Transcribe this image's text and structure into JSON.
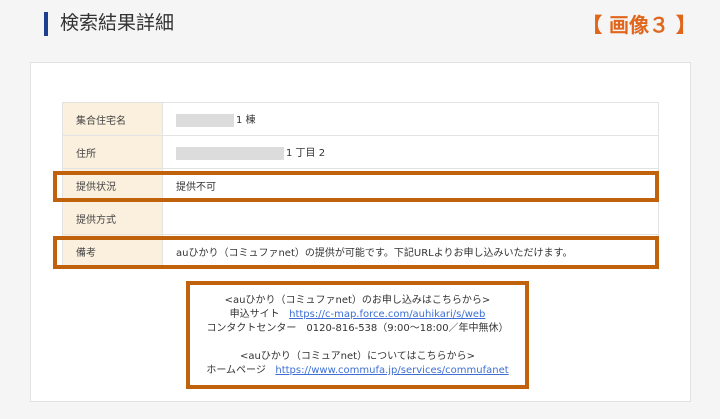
{
  "header": {
    "title": "検索結果詳細",
    "image_label": "【 画像３ 】"
  },
  "table": {
    "rows": [
      {
        "label": "集合住宅名",
        "value": "1 棟"
      },
      {
        "label": "住所",
        "value": "1 丁目 2"
      },
      {
        "label": "提供状況",
        "value": "提供不可"
      },
      {
        "label": "提供方式",
        "value": ""
      },
      {
        "label": "備考",
        "value": "auひかり（コミュファnet）の提供が可能です。下記URLよりお申し込みいただけます。"
      }
    ]
  },
  "notice": {
    "apply_heading": "<auひかり（コミュファnet）のお申し込みはこちらから>",
    "apply_site_label": "申込サイト",
    "apply_site_url": "https://c-map.force.com/auhikari/s/web",
    "contact_line": "コンタクトセンター　0120-816-538（9:00～18:00／年中無休）",
    "about_heading": "<auひかり（コミュアnet）についてはこちらから>",
    "homepage_label": "ホームページ",
    "homepage_url": "https://www.commufa.jp/services/commufanet"
  },
  "colors": {
    "highlight": "#c0620b",
    "header_cell": "#fbf0de",
    "title_bar": "#1d3f8f",
    "image_label": "#e0661c",
    "link": "#3d6fd4"
  }
}
